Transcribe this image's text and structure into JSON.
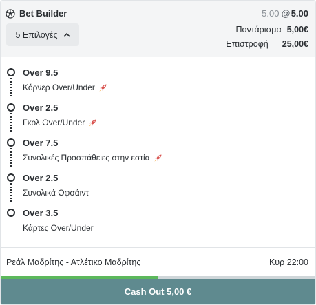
{
  "header": {
    "title": "Bet Builder",
    "original_odds": "5.00",
    "at_symbol": "@",
    "boosted_odds": "5.00",
    "selections_label": "5 Επιλογές",
    "stake_label": "Ποντάρισμα",
    "stake_value": "5,00€",
    "return_label": "Επιστροφή",
    "return_value": "25,00€"
  },
  "legs": [
    {
      "selection": "Over 9.5",
      "market": "Κόρνερ Over/Under",
      "boosted": true
    },
    {
      "selection": "Over 2.5",
      "market": "Γκολ Over/Under",
      "boosted": true
    },
    {
      "selection": "Over 7.5",
      "market": "Συνολικές Προσπάθειες στην εστία",
      "boosted": true
    },
    {
      "selection": "Over 2.5",
      "market": "Συνολικά Οφσάιντ",
      "boosted": false
    },
    {
      "selection": "Over 3.5",
      "market": "Κάρτες Over/Under",
      "boosted": false
    }
  ],
  "event": {
    "name": "Ρεάλ Μαδρίτης - Ατλέτικο Μαδρίτης",
    "time": "Κυρ 22:00"
  },
  "cashout": {
    "label": "Cash Out 5,00 €",
    "progress": 0.5
  },
  "colors": {
    "cashout_bg": "#5f8a8f",
    "progress_fill": "#5cb85c",
    "boost_icon": "#d9534f"
  }
}
